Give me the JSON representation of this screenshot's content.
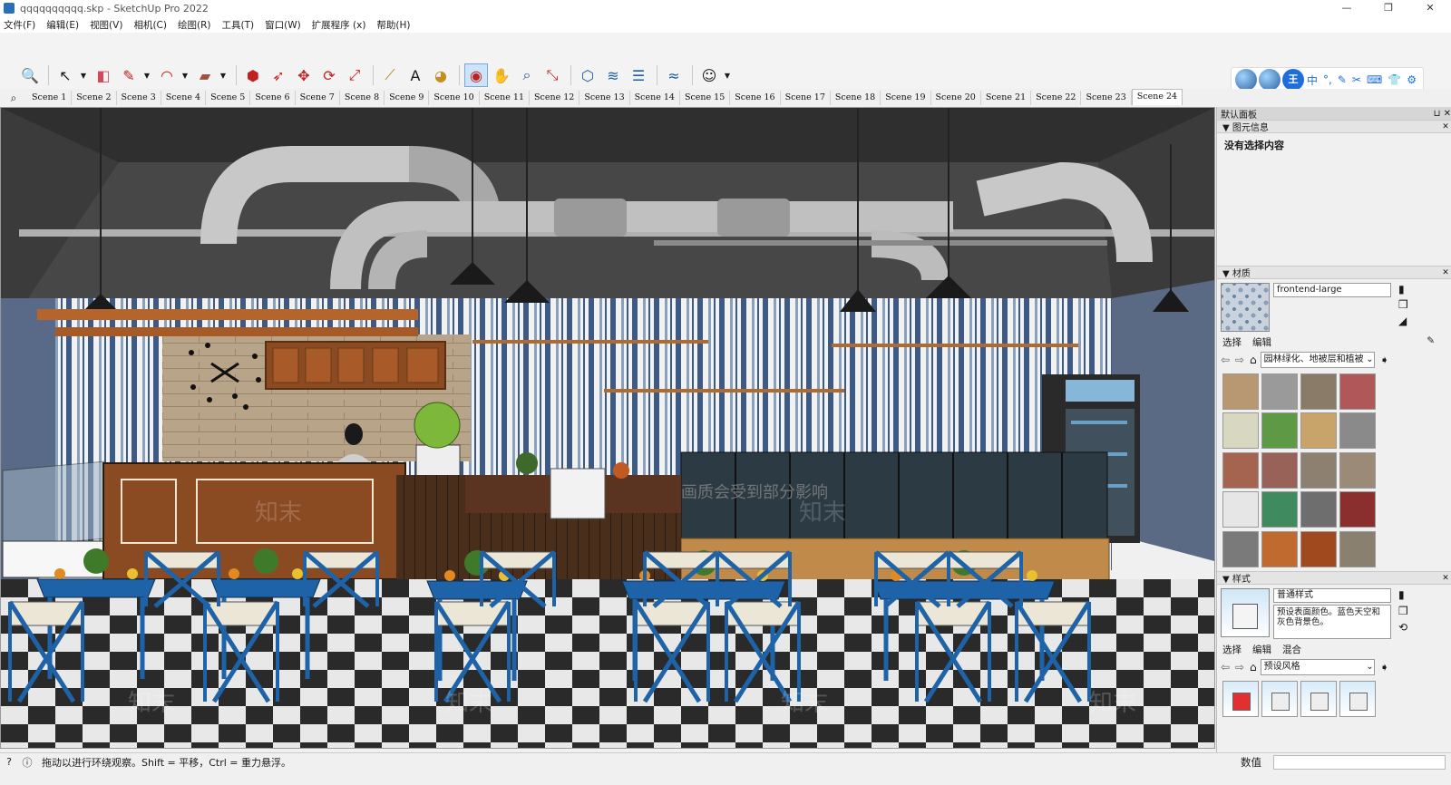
{
  "window": {
    "title": "qqqqqqqqqq.skp - SketchUp Pro 2022",
    "controls": [
      "—",
      "❐",
      "✕"
    ]
  },
  "menu": [
    "文件(F)",
    "编辑(E)",
    "视图(V)",
    "相机(C)",
    "绘图(R)",
    "工具(T)",
    "窗口(W)",
    "扩展程序 (x)",
    "帮助(H)"
  ],
  "toolbar": [
    {
      "name": "zoom-window-icon",
      "glyph": "🔍"
    },
    {
      "name": "select-icon",
      "glyph": "↖"
    },
    {
      "name": "eraser-icon",
      "glyph": "◧"
    },
    {
      "name": "pencil-icon",
      "glyph": "✎"
    },
    {
      "name": "arc-icon",
      "glyph": "◠"
    },
    {
      "name": "rectangle-icon",
      "glyph": "▰"
    },
    {
      "name": "push-pull-icon",
      "glyph": "⬢"
    },
    {
      "name": "follow-me-icon",
      "glyph": "➶"
    },
    {
      "name": "move-icon",
      "glyph": "✥"
    },
    {
      "name": "rotate-icon",
      "glyph": "⟳"
    },
    {
      "name": "scale-icon",
      "glyph": "⤢"
    },
    {
      "name": "tape-measure-icon",
      "glyph": "⟋"
    },
    {
      "name": "text-icon",
      "glyph": "A"
    },
    {
      "name": "paint-bucket-icon",
      "glyph": "◕"
    },
    {
      "name": "orbit-icon",
      "glyph": "◉"
    },
    {
      "name": "pan-icon",
      "glyph": "✋"
    },
    {
      "name": "zoom-icon",
      "glyph": "⌕"
    },
    {
      "name": "zoom-extents-icon",
      "glyph": "⤡"
    },
    {
      "name": "warehouse-icon",
      "glyph": "⬡"
    },
    {
      "name": "extension-icon",
      "glyph": "≋"
    },
    {
      "name": "layers-icon",
      "glyph": "☰"
    },
    {
      "name": "sandbox-icon",
      "glyph": "≈"
    },
    {
      "name": "account-icon",
      "glyph": "☺"
    }
  ],
  "ime": {
    "main": "王",
    "items": [
      "中",
      "°,",
      "✎",
      "✂",
      "⌨",
      "👕",
      "⚙"
    ]
  },
  "scenes": [
    "Scene 1",
    "Scene 2",
    "Scene 3",
    "Scene 4",
    "Scene 5",
    "Scene 6",
    "Scene 7",
    "Scene 8",
    "Scene 9",
    "Scene 10",
    "Scene 11",
    "Scene 12",
    "Scene 13",
    "Scene 14",
    "Scene 15",
    "Scene 16",
    "Scene 17",
    "Scene 18",
    "Scene 19",
    "Scene 20",
    "Scene 21",
    "Scene 22",
    "Scene 23",
    "Scene 24"
  ],
  "active_scene": "Scene 24",
  "viewport": {
    "overlay_text": "画质会受到部分影响",
    "watermark": "知末",
    "colors": {
      "ceiling": "#3b3b3b",
      "wall_stripe_a": "#3c5a86",
      "wall_stripe_b": "#f2f2f2",
      "table": "#1e63a8",
      "counter": "#8a4a22",
      "floor_dark": "#2a2a2a",
      "floor_light": "#e8e8e8",
      "pipe": "#c8c8c8"
    }
  },
  "tray": {
    "title": "默认面板",
    "entity_info": {
      "title": "图元信息",
      "body": "没有选择内容"
    },
    "materials": {
      "title": "材质",
      "name": "frontend-large",
      "tabs": [
        "选择",
        "编辑"
      ],
      "collection": "园林绿化、地被层和植被",
      "swatches": [
        "#b89870",
        "#9a9a9a",
        "#8a7a68",
        "#b0575a",
        "#d8d8c0",
        "#5e9a45",
        "#c8a46a",
        "#8a8a8a",
        "#a46450",
        "#986258",
        "#8e8070",
        "#9c8a78",
        "#e6e6e6",
        "#3f8a5e",
        "#6e6e6e",
        "#8a2e2e",
        "#7a7a7a",
        "#c06a30",
        "#a0481e",
        "#8a8070"
      ]
    },
    "styles": {
      "title": "样式",
      "name": "普通样式",
      "description": "预设表面颜色。蓝色天空和灰色背景色。",
      "tabs": [
        "选择",
        "编辑",
        "混合"
      ],
      "collection": "预设风格"
    }
  },
  "status": {
    "message": "拖动以进行环绕观察。Shift = 平移，Ctrl = 重力悬浮。",
    "value_label": "数值"
  }
}
